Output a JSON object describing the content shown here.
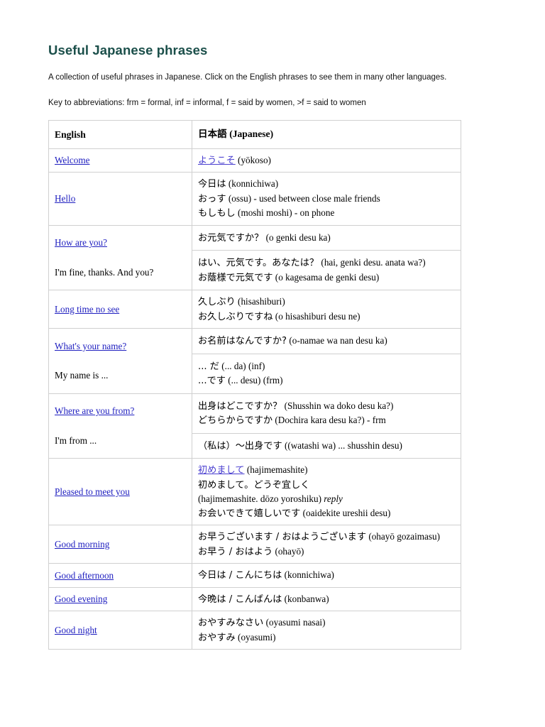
{
  "page": {
    "title": "Useful Japanese phrases",
    "intro": "A collection of useful phrases in Japanese. Click on the English phrases to see them in many other languages.",
    "key": "Key to abbreviations: frm = formal, inf = informal, f = said by women, >f = said to women",
    "title_color": "#1b4f4a",
    "link_color": "#2020c0",
    "jp_link_color": "#4a3fd0"
  },
  "table": {
    "headers": {
      "english": "English",
      "japanese_native": "日本語",
      "japanese_paren": "(Japanese)"
    },
    "rows": [
      {
        "english": [
          {
            "text": "Welcome",
            "link": true
          }
        ],
        "cells": [
          {
            "lines": [
              {
                "link_jp": "ようこそ",
                "rest": " (yōkoso)"
              }
            ]
          }
        ]
      },
      {
        "english": [
          {
            "text": "Hello",
            "link": true
          }
        ],
        "cells": [
          {
            "lines": [
              {
                "jp": "今日は",
                "rest": " (konnichiwa)"
              },
              {
                "jp": "おっす",
                "rest": " (ossu) - used between close male friends"
              },
              {
                "jp": "もしもし",
                "rest": " (moshi moshi) - on phone"
              }
            ]
          }
        ]
      },
      {
        "english": [
          {
            "text": "How are you?",
            "link": true
          },
          {
            "text": "I'm fine, thanks. And you?",
            "link": false
          }
        ],
        "cells": [
          {
            "lines": [
              {
                "jp": "お元気ですか？",
                "rest": " (o genki desu ka)"
              }
            ]
          },
          {
            "lines": [
              {
                "jp": "はい、元気です。あなたは？",
                "rest": " (hai, genki desu. anata wa?)"
              },
              {
                "jp": "お蔭様で元気です",
                "rest": " (o kagesama de genki desu)"
              }
            ]
          }
        ]
      },
      {
        "english": [
          {
            "text": "Long time no see",
            "link": true
          }
        ],
        "cells": [
          {
            "lines": [
              {
                "jp": "久しぶり",
                "rest": " (hisashiburi)"
              },
              {
                "jp": "お久しぶりですね",
                "rest": " (o hisashiburi desu ne)"
              }
            ]
          }
        ]
      },
      {
        "english": [
          {
            "text": "What's your name?",
            "link": true
          },
          {
            "text": "My name is ...",
            "link": false
          }
        ],
        "cells": [
          {
            "lines": [
              {
                "jp": "お名前はなんですか?",
                "rest": " (o-namae wa nan desu ka)"
              }
            ]
          },
          {
            "lines": [
              {
                "jp": "... だ",
                "rest": " (... da) (inf)"
              },
              {
                "jp": "...です",
                "rest": " (... desu) (frm)"
              }
            ]
          }
        ]
      },
      {
        "english": [
          {
            "text": "Where are you from?",
            "link": true
          },
          {
            "text": "I'm from ...",
            "link": false
          }
        ],
        "cells": [
          {
            "lines": [
              {
                "jp": "出身はどこですか？",
                "rest": " (Shusshin wa doko desu ka?)"
              },
              {
                "jp": "どちらからですか",
                "rest": " (Dochira kara desu ka?) - frm"
              }
            ]
          },
          {
            "lines": [
              {
                "jp": "（私は）〜出身です",
                "rest": " ((watashi wa) ... shusshin desu)"
              }
            ]
          }
        ]
      },
      {
        "english": [
          {
            "text": "Pleased to meet you",
            "link": true
          }
        ],
        "cells": [
          {
            "lines": [
              {
                "link_jp": "初めまして",
                "rest": " (hajimemashite)"
              },
              {
                "jp": "初めまして。どうぞ宜しく",
                "rest": ""
              },
              {
                "jp": "",
                "rest": "(hajimemashite. dōzo yoroshiku) ",
                "italic": "reply"
              },
              {
                "jp": "お会いできて嬉しいです",
                "rest": " (oaidekite ureshii desu)"
              }
            ]
          }
        ]
      },
      {
        "english": [
          {
            "text": "Good morning",
            "link": true
          }
        ],
        "cells": [
          {
            "lines": [
              {
                "jp": "お早うございます / おはようございます",
                "rest": " (ohayō gozaimasu)"
              },
              {
                "jp": "お早う / おはよう",
                "rest": " (ohayō)"
              }
            ]
          }
        ]
      },
      {
        "english": [
          {
            "text": "Good afternoon",
            "link": true
          }
        ],
        "cells": [
          {
            "lines": [
              {
                "jp": "今日は / こんにちは",
                "rest": " (konnichiwa)"
              }
            ]
          }
        ]
      },
      {
        "english": [
          {
            "text": "Good evening",
            "link": true
          }
        ],
        "cells": [
          {
            "lines": [
              {
                "jp": "今晩は / こんばんは",
                "rest": " (konbanwa)"
              }
            ]
          }
        ]
      },
      {
        "english": [
          {
            "text": "Good night",
            "link": true
          }
        ],
        "cells": [
          {
            "lines": [
              {
                "jp": "おやすみなさい",
                "rest": " (oyasumi nasai)"
              },
              {
                "jp": "おやすみ",
                "rest": " (oyasumi)"
              }
            ]
          }
        ]
      }
    ]
  }
}
